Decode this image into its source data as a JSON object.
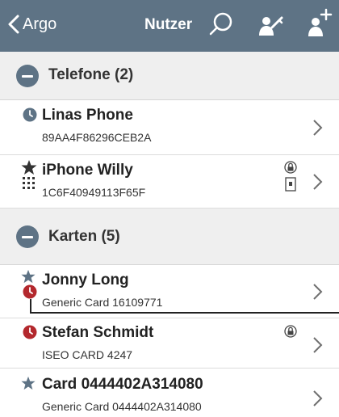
{
  "navbar": {
    "back_label": "Argo",
    "title": "Nutzer",
    "icons": [
      "search-icon",
      "user-key-icon",
      "add-user-icon"
    ],
    "bar_color": "#5e7385"
  },
  "sections": [
    {
      "title": "Telefone (2)",
      "items": [
        {
          "title": "Linas Phone",
          "subtitle": "89AA4F86296CEB2A",
          "lead_icon": "clock-icon"
        },
        {
          "title": "iPhone Willy",
          "subtitle": "1C6F40949113F65F",
          "lead_icon": "star-icon",
          "extra_icons": [
            "keypad-icon",
            "lock-icon",
            "phone-card-icon"
          ]
        }
      ]
    },
    {
      "title": "Karten (5)",
      "items": [
        {
          "title": "Jonny Long",
          "subtitle": "Generic Card 16109771",
          "lead_icon": "star-icon",
          "extra_icons": [
            "red-clock-icon"
          ]
        },
        {
          "title": "Stefan Schmidt",
          "subtitle": "ISEO CARD 4247",
          "lead_icon": "red-clock-icon",
          "extra_icons": [
            "lock-icon"
          ]
        },
        {
          "title": "Card 0444402A314080",
          "subtitle": "Generic Card 0444402A314080",
          "lead_icon": "star-icon"
        }
      ]
    }
  ],
  "colors": {
    "accent": "#5e7385",
    "alert": "#b3282d"
  }
}
